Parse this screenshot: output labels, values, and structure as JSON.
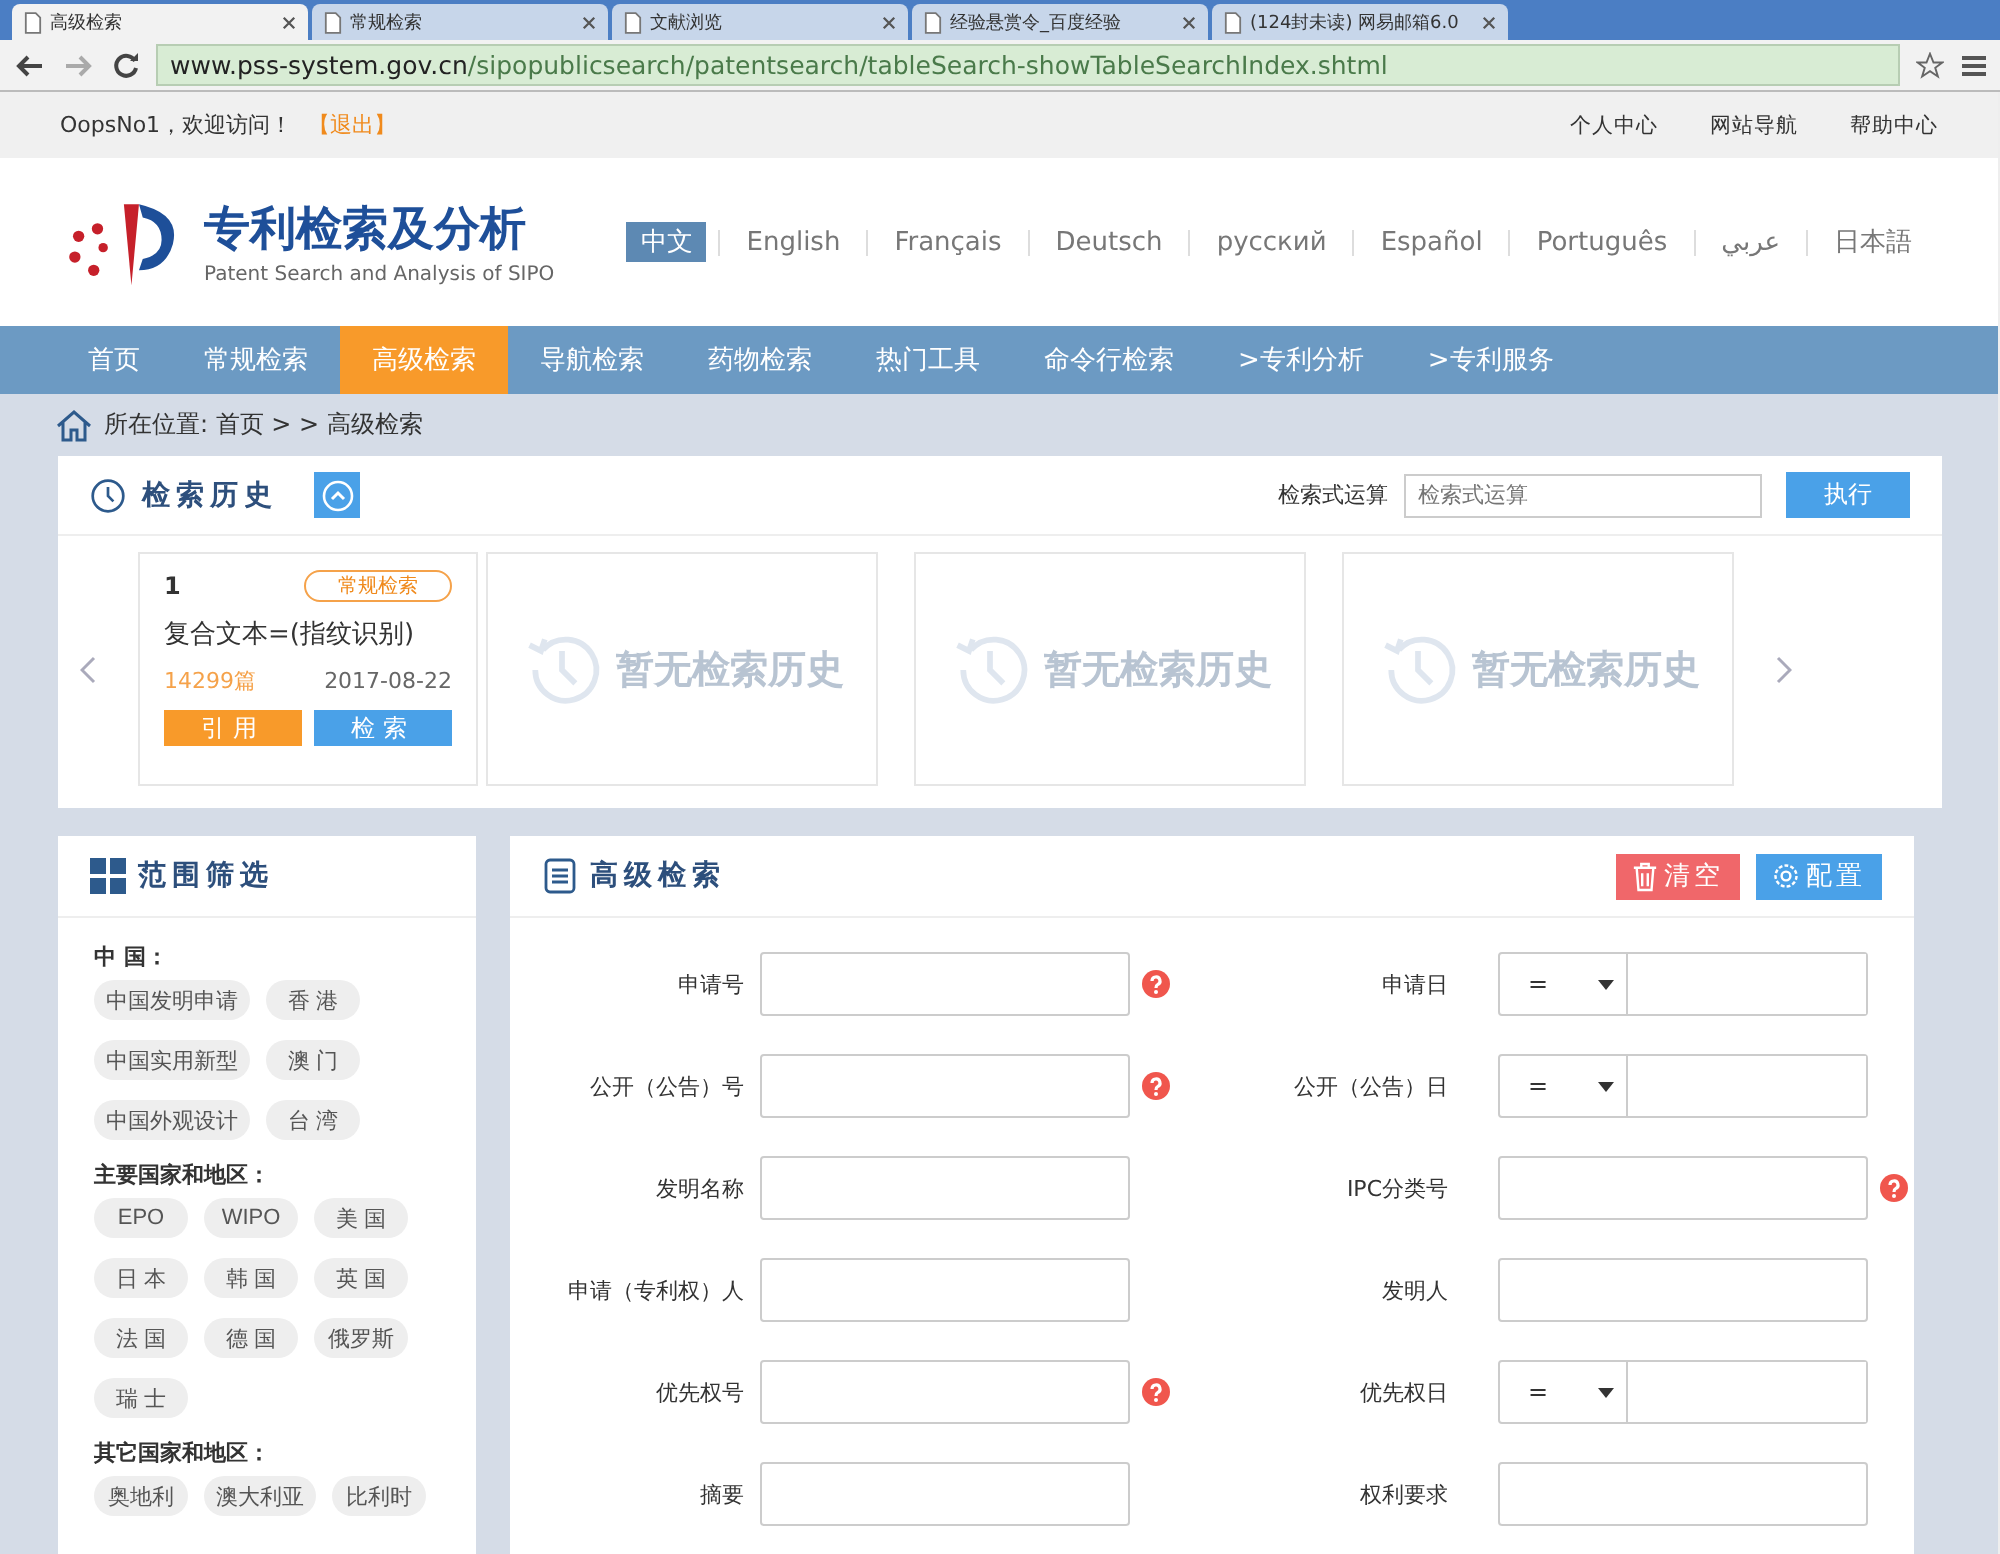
{
  "browser": {
    "tabs": [
      {
        "title": "高级检索",
        "selected": true
      },
      {
        "title": "常规检索",
        "selected": false
      },
      {
        "title": "文献浏览",
        "selected": false
      },
      {
        "title": "经验悬赏令_百度经验",
        "selected": false
      },
      {
        "title": "(124封未读) 网易邮箱6.0",
        "selected": false
      }
    ],
    "url_host": "www.pss-system.gov.cn",
    "url_path": "/sipopublicsearch/patentsearch/tableSearch-showTableSearchIndex.shtml"
  },
  "top_bar": {
    "greeting": "OopsNo1，欢迎访问！",
    "logout": "【退出】",
    "links": [
      "个人中心",
      "网站导航",
      "帮助中心"
    ]
  },
  "header": {
    "title": "专利检索及分析",
    "subtitle": "Patent Search and Analysis of SIPO",
    "languages": [
      {
        "label": "中文",
        "selected": true
      },
      {
        "label": "English",
        "selected": false
      },
      {
        "label": "Français",
        "selected": false
      },
      {
        "label": "Deutsch",
        "selected": false
      },
      {
        "label": "русский",
        "selected": false
      },
      {
        "label": "Español",
        "selected": false
      },
      {
        "label": "Português",
        "selected": false
      },
      {
        "label": "عربي",
        "selected": false
      },
      {
        "label": "日本語",
        "selected": false
      }
    ]
  },
  "nav": [
    {
      "label": "首页",
      "selected": false
    },
    {
      "label": "常规检索",
      "selected": false
    },
    {
      "label": "高级检索",
      "selected": true
    },
    {
      "label": "导航检索",
      "selected": false
    },
    {
      "label": "药物检索",
      "selected": false
    },
    {
      "label": "热门工具",
      "selected": false
    },
    {
      "label": "命令行检索",
      "selected": false
    },
    {
      "label": ">专利分析",
      "selected": false
    },
    {
      "label": ">专利服务",
      "selected": false
    }
  ],
  "breadcrumb": "所在位置: 首页 > > 高级检索",
  "history": {
    "title": "检索历史",
    "formula_label": "检索式运算",
    "formula_placeholder": "检索式运算",
    "run_button": "执行",
    "card": {
      "number": "1",
      "tag": "常规检索",
      "query": "复合文本=(指纹识别)",
      "count": "14299篇",
      "date": "2017-08-22",
      "cite_button": "引用",
      "search_button": "检索"
    },
    "empty": [
      "暂无检索历史",
      "暂无检索历史",
      "暂无检索历史"
    ]
  },
  "filter": {
    "title": "范围筛选",
    "groups": [
      {
        "label": "中 国：",
        "chips": [
          "中国发明申请",
          "香 港",
          "中国实用新型",
          "澳 门",
          "中国外观设计",
          "台 湾"
        ]
      },
      {
        "label": "主要国家和地区：",
        "chips": [
          "EPO",
          "WIPO",
          "美 国",
          "日 本",
          "韩 国",
          "英 国",
          "法 国",
          "德 国",
          "俄罗斯",
          "瑞 士"
        ]
      },
      {
        "label": "其它国家和地区：",
        "chips": [
          "奥地利",
          "澳大利亚",
          "比利时"
        ]
      }
    ]
  },
  "search": {
    "title": "高级检索",
    "clear_button": "清空",
    "config_button": "配置",
    "rows": [
      [
        {
          "label": "申请号",
          "kind": "text",
          "help": true
        },
        {
          "label": "申请日",
          "kind": "date",
          "operator": "=",
          "help": false
        }
      ],
      [
        {
          "label": "公开（公告）号",
          "kind": "text",
          "help": true
        },
        {
          "label": "公开（公告）日",
          "kind": "date",
          "operator": "=",
          "help": false
        }
      ],
      [
        {
          "label": "发明名称",
          "kind": "text",
          "help": false
        },
        {
          "label": "IPC分类号",
          "kind": "text",
          "help": true
        }
      ],
      [
        {
          "label": "申请（专利权）人",
          "kind": "text",
          "help": false
        },
        {
          "label": "发明人",
          "kind": "text",
          "help": false
        }
      ],
      [
        {
          "label": "优先权号",
          "kind": "text",
          "help": true
        },
        {
          "label": "优先权日",
          "kind": "date",
          "operator": "=",
          "help": false
        }
      ],
      [
        {
          "label": "摘要",
          "kind": "text",
          "help": false
        },
        {
          "label": "权利要求",
          "kind": "text",
          "help": false
        }
      ]
    ]
  }
}
